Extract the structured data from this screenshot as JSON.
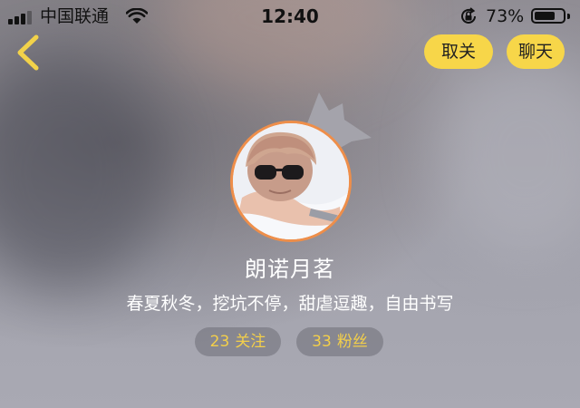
{
  "status_bar": {
    "carrier": "中国联通",
    "time": "12:40",
    "battery_percent": "73%",
    "battery_level": 0.73,
    "icons": [
      "signal-bars-icon",
      "wifi-icon",
      "orientation-lock-icon",
      "battery-icon"
    ]
  },
  "nav": {
    "back_icon": "chevron-left-icon",
    "unfollow_label": "取关",
    "chat_label": "聊天"
  },
  "profile": {
    "avatar_badge_icon": "crown-icon",
    "username": "朗诺月茗",
    "bio": "春夏秋冬，挖坑不停，甜虐逗趣，自由书写",
    "following": {
      "count": "23",
      "label": "关注"
    },
    "followers": {
      "count": "33",
      "label": "粉丝"
    }
  },
  "colors": {
    "button_yellow": "#f7d649",
    "stat_text_yellow": "#f3cf4a",
    "avatar_border": "#ee8e4a",
    "back_chevron": "#f2d24a"
  }
}
